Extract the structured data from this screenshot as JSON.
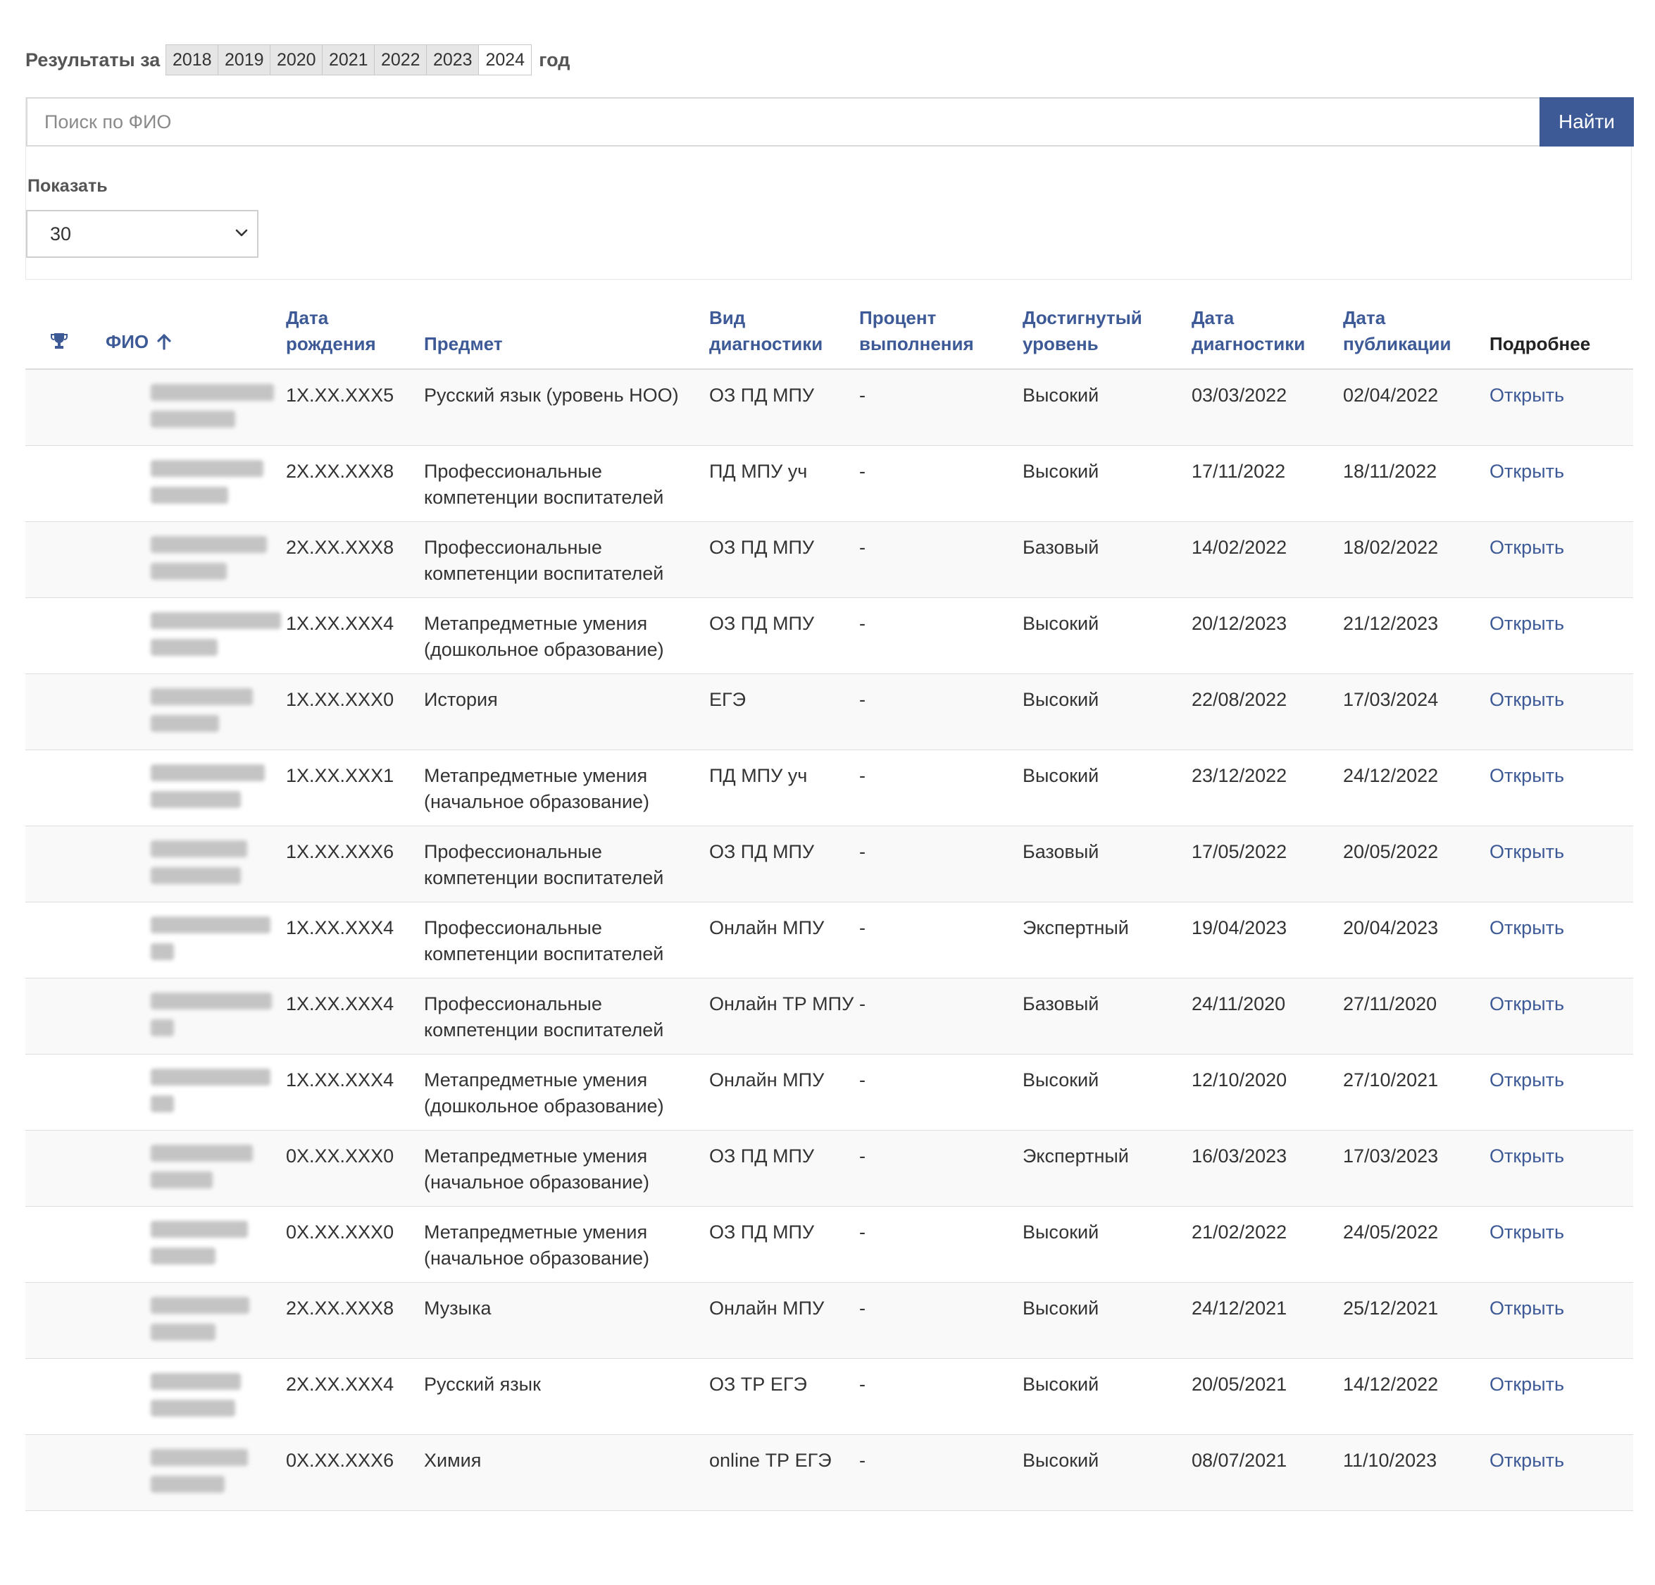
{
  "years": {
    "label": "Результаты за",
    "suffix": "год",
    "options": [
      "2018",
      "2019",
      "2020",
      "2021",
      "2022",
      "2023",
      "2024"
    ],
    "selected": "2024"
  },
  "search": {
    "placeholder": "Поиск по ФИО",
    "value": "",
    "button": "Найти"
  },
  "show": {
    "label": "Показать",
    "value": "30"
  },
  "table": {
    "headers": {
      "trophy": "",
      "fio": "ФИО",
      "birth": "Дата рождения",
      "subject": "Предмет",
      "diag_type": "Вид диагностики",
      "percent": "Процент выполнения",
      "level": "Достигнутый уровень",
      "diag_date": "Дата диагностики",
      "pub_date": "Дата публикации",
      "details": "Подробнее"
    },
    "sort_icon": "arrow-up-icon",
    "rows": [
      {
        "birth": "1X.XX.XXX5",
        "subject": "Русский язык (уровень НОО)",
        "type": "ОЗ ПД МПУ",
        "percent": "-",
        "level": "Высокий",
        "diag": "03/03/2022",
        "pub": "02/04/2022",
        "link": "Открыть"
      },
      {
        "birth": "2X.XX.XXX8",
        "subject": "Профессиональные компетенции воспитателей",
        "type": "ПД МПУ уч",
        "percent": "-",
        "level": "Высокий",
        "diag": "17/11/2022",
        "pub": "18/11/2022",
        "link": "Открыть"
      },
      {
        "birth": "2X.XX.XXX8",
        "subject": "Профессиональные компетенции воспитателей",
        "type": "ОЗ ПД МПУ",
        "percent": "-",
        "level": "Базовый",
        "diag": "14/02/2022",
        "pub": "18/02/2022",
        "link": "Открыть"
      },
      {
        "birth": "1X.XX.XXX4",
        "subject": "Метапредметные умения (дошкольное образование)",
        "type": "ОЗ ПД МПУ",
        "percent": "-",
        "level": "Высокий",
        "diag": "20/12/2023",
        "pub": "21/12/2023",
        "link": "Открыть"
      },
      {
        "birth": "1X.XX.XXX0",
        "subject": "История",
        "type": "ЕГЭ",
        "percent": "-",
        "level": "Высокий",
        "diag": "22/08/2022",
        "pub": "17/03/2024",
        "link": "Открыть"
      },
      {
        "birth": "1X.XX.XXX1",
        "subject": "Метапредметные умения (начальное образование)",
        "type": "ПД МПУ уч",
        "percent": "-",
        "level": "Высокий",
        "diag": "23/12/2022",
        "pub": "24/12/2022",
        "link": "Открыть"
      },
      {
        "birth": "1X.XX.XXX6",
        "subject": "Профессиональные компетенции воспитателей",
        "type": "ОЗ ПД МПУ",
        "percent": "-",
        "level": "Базовый",
        "diag": "17/05/2022",
        "pub": "20/05/2022",
        "link": "Открыть"
      },
      {
        "birth": "1X.XX.XXX4",
        "subject": "Профессиональные компетенции воспитателей",
        "type": "Онлайн МПУ",
        "percent": "-",
        "level": "Экспертный",
        "diag": "19/04/2023",
        "pub": "20/04/2023",
        "link": "Открыть"
      },
      {
        "birth": "1X.XX.XXX4",
        "subject": "Профессиональные компетенции воспитателей",
        "type": "Онлайн ТР МПУ",
        "percent": "-",
        "level": "Базовый",
        "diag": "24/11/2020",
        "pub": "27/11/2020",
        "link": "Открыть"
      },
      {
        "birth": "1X.XX.XXX4",
        "subject": "Метапредметные умения (дошкольное образование)",
        "type": "Онлайн МПУ",
        "percent": "-",
        "level": "Высокий",
        "diag": "12/10/2020",
        "pub": "27/10/2021",
        "link": "Открыть"
      },
      {
        "birth": "0X.XX.XXX0",
        "subject": "Метапредметные умения (начальное образование)",
        "type": "ОЗ ПД МПУ",
        "percent": "-",
        "level": "Экспертный",
        "diag": "16/03/2023",
        "pub": "17/03/2023",
        "link": "Открыть"
      },
      {
        "birth": "0X.XX.XXX0",
        "subject": "Метапредметные умения (начальное образование)",
        "type": "ОЗ ПД МПУ",
        "percent": "-",
        "level": "Высокий",
        "diag": "21/02/2022",
        "pub": "24/05/2022",
        "link": "Открыть"
      },
      {
        "birth": "2X.XX.XXX8",
        "subject": "Музыка",
        "type": "Онлайн МПУ",
        "percent": "-",
        "level": "Высокий",
        "diag": "24/12/2021",
        "pub": "25/12/2021",
        "link": "Открыть"
      },
      {
        "birth": "2X.XX.XXX4",
        "subject": "Русский язык",
        "type": "ОЗ ТР ЕГЭ",
        "percent": "-",
        "level": "Высокий",
        "diag": "20/05/2021",
        "pub": "14/12/2022",
        "link": "Открыть"
      },
      {
        "birth": "0X.XX.XXX6",
        "subject": "Химия",
        "type": "online ТР ЕГЭ",
        "percent": "-",
        "level": "Высокий",
        "diag": "08/07/2021",
        "pub": "11/10/2023",
        "link": "Открыть"
      }
    ]
  },
  "colors": {
    "accent": "#3d5a97",
    "row_stripe": "#f9f9f9",
    "border": "#dddddd"
  }
}
